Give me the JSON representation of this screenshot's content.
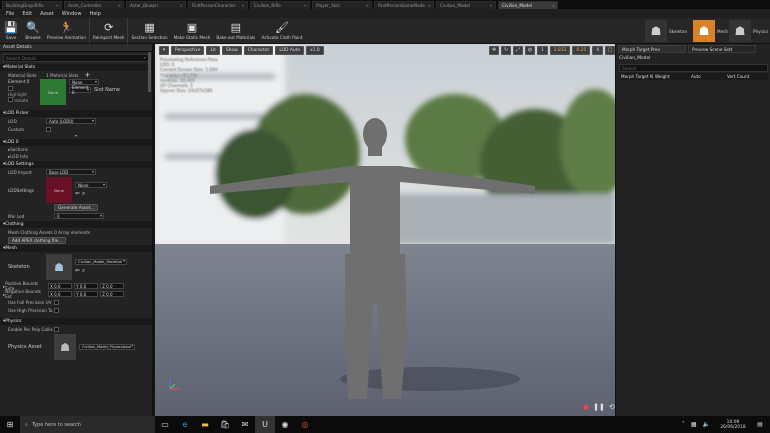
{
  "tabs": [
    "BuildingDrop/Rifle",
    "Anim_Controller",
    "Actor_Bluepri",
    "FirstPersonCharacter",
    "Civilian_Rifle",
    "Player_Skill",
    "FirstPersonGameMode",
    "Civilian_Model",
    "Civilian_Model"
  ],
  "menu": [
    "File",
    "Edit",
    "Asset",
    "Window",
    "Help"
  ],
  "toolbar": [
    "Save",
    "Browse",
    "Preview Animation",
    "Reimport Mesh",
    "Section Selection",
    "Make Static Mesh",
    "Bake out Materials",
    "Activate Cloth Paint"
  ],
  "modes": {
    "skeleton": "Skeleton",
    "mesh": "Mesh",
    "physics": "Physics"
  },
  "left": {
    "tab": "Asset Details",
    "search_placeholder": "Search Details",
    "material_slots": {
      "header": "Material Slots",
      "label": "Material Slots",
      "count": "1 Material Slots",
      "element": "Element 0",
      "highlight": "Highlight",
      "isolate": "Isolate",
      "thumb": "None",
      "value": "None",
      "slot_name": "Slot Name",
      "slot_value": "Element 0"
    },
    "lod_picker": {
      "header": "LOD Picker",
      "lod_label": "LOD",
      "lod_value": "Auto (LOD0)",
      "custom": "Custom"
    },
    "lod0": {
      "header": "LOD 0",
      "sections": "Sections",
      "lod_info": "LOD Info"
    },
    "lod_settings": {
      "header": "LOD Settings",
      "import": "LOD Import",
      "import_value": "Base LOD",
      "settings": "LODSettings",
      "thumb": "None",
      "value": "None",
      "generate": "Generate Asset...",
      "minlod": "Min Lod",
      "minlod_value": "0"
    },
    "clothing": {
      "header": "Clothing",
      "label": "Mesh Clothing Assets",
      "value": "0 Array elements",
      "button": "Add APEX clothing file..."
    },
    "mesh": {
      "header": "Mesh",
      "skeleton": "Skeleton",
      "skeleton_value": "Civilian_Model_Skeleton",
      "pos": "Positive Bounds Exte",
      "neg": "Negative Bounds Ext",
      "x": "X 0.0",
      "y": "Y 0.0",
      "z": "Z 0.0",
      "fullprec": "Use Full Precision UV",
      "highprec": "Use High Precision Ta"
    },
    "physics": {
      "header": "Physics",
      "enable": "Enable Per Poly Collis",
      "asset": "Physics Asset",
      "asset_value": "Civilian_Model_PhysicsAsse"
    }
  },
  "viewport": {
    "buttons": [
      "Perspective",
      "Lit",
      "Show",
      "Character",
      "LOD Auto",
      "x1.0"
    ],
    "right": [
      "1",
      "2.812",
      "0.25",
      "4"
    ],
    "stats": [
      "Previewing Reference Pose",
      "LOD: 0",
      "Current Screen Size: 1.004",
      "Triangles: 49,226",
      "Vertices: 28,465",
      "UV Channels: 1",
      "Approx Size: 24x57x180"
    ]
  },
  "right": {
    "tab1": "Morph Target Prev",
    "tab2": "Preview Scene Sett",
    "name": "Civilian_Model",
    "search": "Search",
    "cols": [
      "Morph Target N",
      "Weight",
      "Auto",
      "Vert Count"
    ]
  },
  "taskbar": {
    "search": "Type here to search",
    "time": "10:09",
    "date": "26/06/2018"
  }
}
